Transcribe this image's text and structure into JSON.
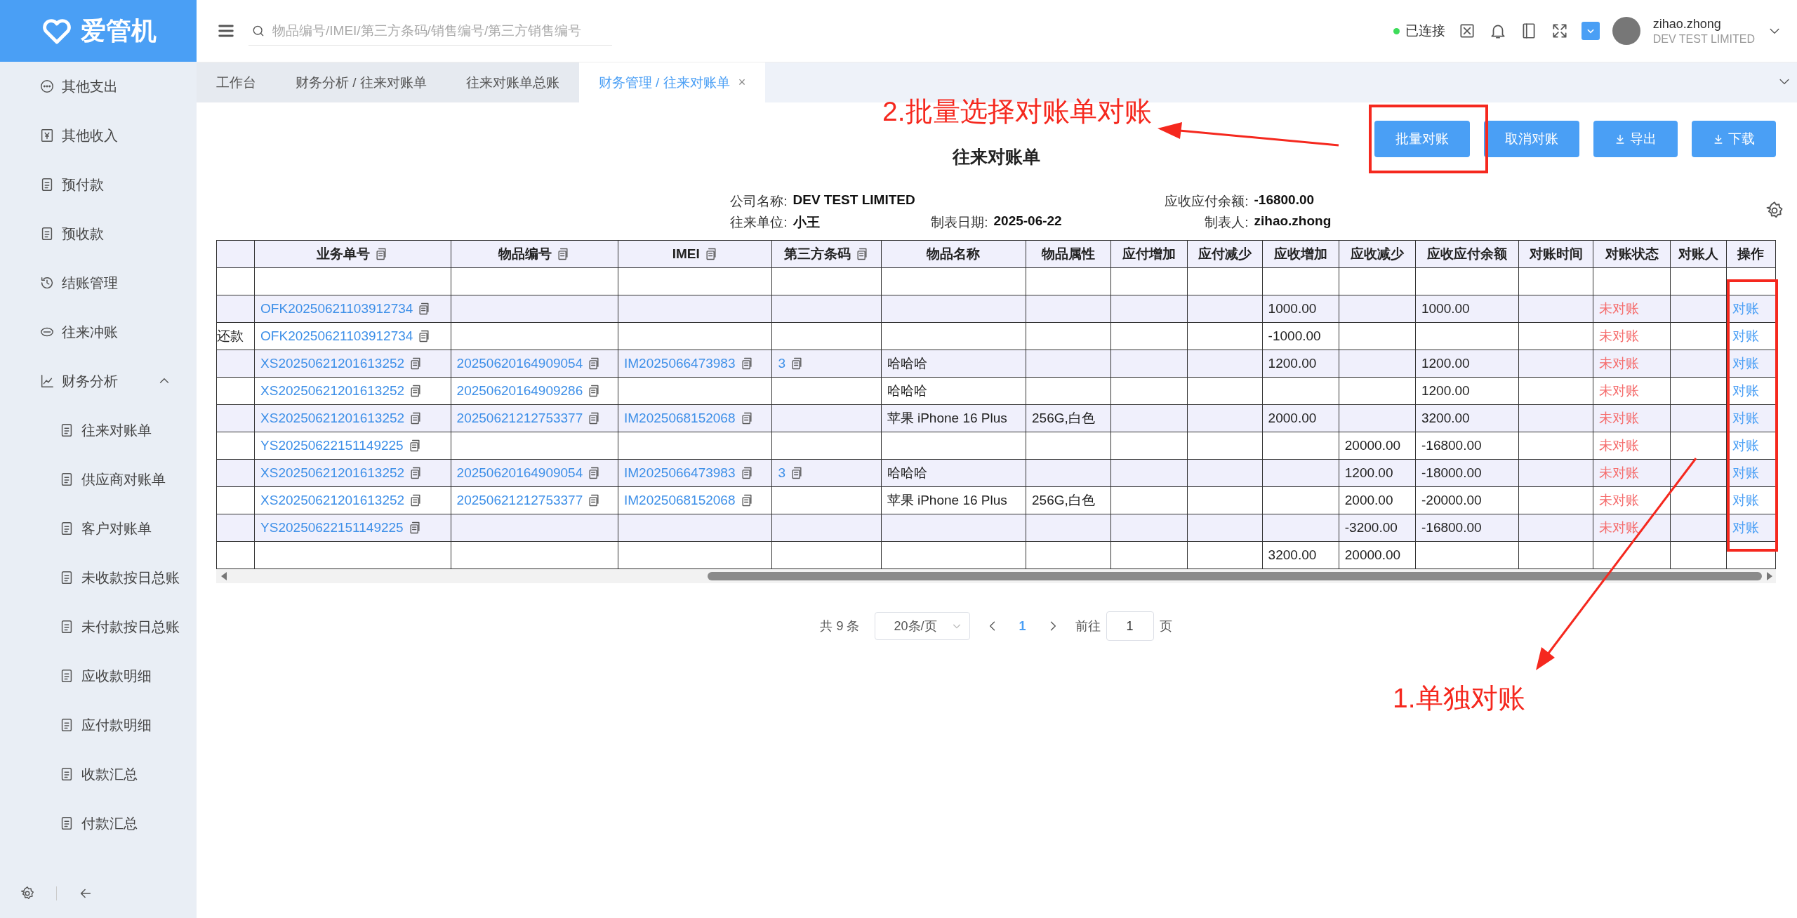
{
  "app": {
    "logo": "爱管机"
  },
  "sidebar": {
    "items": [
      {
        "label": "其他支出"
      },
      {
        "label": "其他收入"
      },
      {
        "label": "预付款"
      },
      {
        "label": "预收款"
      },
      {
        "label": "结账管理"
      },
      {
        "label": "往来冲账"
      },
      {
        "label": "财务分析",
        "expanded": true,
        "children": [
          {
            "label": "往来对账单"
          },
          {
            "label": "供应商对账单"
          },
          {
            "label": "客户对账单"
          },
          {
            "label": "未收款按日总账"
          },
          {
            "label": "未付款按日总账"
          },
          {
            "label": "应收款明细"
          },
          {
            "label": "应付款明细"
          },
          {
            "label": "收款汇总"
          },
          {
            "label": "付款汇总"
          }
        ]
      }
    ]
  },
  "header": {
    "search": {
      "placeholder": "物品编号/IMEI/第三方条码/销售编号/第三方销售编号"
    },
    "connection": {
      "label": "已连接",
      "connected": true
    },
    "user": {
      "name": "zihao.zhong",
      "company": "DEV TEST LIMITED"
    }
  },
  "tabs": [
    {
      "label": "工作台",
      "selected": false
    },
    {
      "label": "财务分析 / 往来对账单",
      "selected": false
    },
    {
      "label": "往来对账单总账",
      "selected": false
    },
    {
      "label": "财务管理 / 往来对账单",
      "selected": true,
      "close": "×"
    }
  ],
  "toolbar": {
    "buttons": [
      {
        "label": "批量对账",
        "kind": "plain"
      },
      {
        "label": "取消对账",
        "kind": "plain"
      },
      {
        "label": "导出",
        "kind": "download"
      },
      {
        "label": "下载",
        "kind": "download"
      }
    ]
  },
  "report": {
    "title": "往来对账单",
    "info": [
      {
        "label": "公司名称:",
        "value": "DEV TEST LIMITED"
      },
      {
        "label": "应收应付余额:",
        "value": "-16800.00"
      },
      {
        "label": "往来单位:",
        "value": "小王"
      },
      {
        "label": "制表日期:",
        "value": "2025-06-22"
      },
      {
        "label": "制表人:",
        "value": "zihao.zhong"
      }
    ]
  },
  "table": {
    "columns": [
      {
        "copy_icon": false
      },
      {
        "label": "业务单号",
        "copy_icon": true
      },
      {
        "label": "物品编号",
        "copy_icon": true
      },
      {
        "label": "IMEI",
        "copy_icon": true
      },
      {
        "label": "第三方条码",
        "copy_icon": true
      },
      {
        "label": "物品名称",
        "copy_icon": false
      },
      {
        "label": "物品属性",
        "copy_icon": false
      },
      {
        "label": "应付增加",
        "copy_icon": false
      },
      {
        "label": "应付减少",
        "copy_icon": false
      },
      {
        "label": "应收增加",
        "copy_icon": false
      },
      {
        "label": "应收减少",
        "copy_icon": false
      },
      {
        "label": "应收应付余额",
        "copy_icon": false
      },
      {
        "label": "对账时间",
        "copy_icon": false
      },
      {
        "label": "对账状态",
        "copy_icon": false
      },
      {
        "label": "对账人",
        "copy_icon": false
      },
      {
        "label": "操作",
        "copy_icon": false
      }
    ],
    "rows": [
      {
        "cells": [
          null,
          null,
          null,
          null,
          null,
          null,
          null,
          null,
          null,
          null,
          null,
          null,
          null,
          null,
          null,
          null
        ]
      },
      {
        "cells": [
          null,
          {
            "text": "OFK20250621103912734",
            "kind": "link",
            "copy_icon": true
          },
          null,
          null,
          null,
          null,
          null,
          null,
          null,
          {
            "text": "1000.00",
            "kind": "text"
          },
          null,
          {
            "text": "1000.00",
            "kind": "text"
          },
          null,
          {
            "text": "未对账",
            "kind": "status"
          },
          null,
          {
            "text": "对账",
            "kind": "action"
          }
        ]
      },
      {
        "cells": [
          {
            "text": "还款",
            "kind": "text"
          },
          {
            "text": "OFK20250621103912734",
            "kind": "link",
            "copy_icon": true
          },
          null,
          null,
          null,
          null,
          null,
          null,
          null,
          {
            "text": "-1000.00",
            "kind": "text"
          },
          null,
          null,
          null,
          {
            "text": "未对账",
            "kind": "status"
          },
          null,
          {
            "text": "对账",
            "kind": "action"
          }
        ]
      },
      {
        "cells": [
          null,
          {
            "text": "XS20250621201613252",
            "kind": "link",
            "copy_icon": true
          },
          {
            "text": "20250620164909054",
            "kind": "link",
            "copy_icon": true
          },
          {
            "text": "IM2025066473983",
            "kind": "link",
            "copy_icon": true
          },
          {
            "text": "3",
            "kind": "link",
            "copy_icon": true
          },
          {
            "text": "哈哈哈",
            "kind": "text"
          },
          null,
          null,
          null,
          {
            "text": "1200.00",
            "kind": "text"
          },
          null,
          {
            "text": "1200.00",
            "kind": "text"
          },
          null,
          {
            "text": "未对账",
            "kind": "status"
          },
          null,
          {
            "text": "对账",
            "kind": "action"
          }
        ]
      },
      {
        "cells": [
          null,
          {
            "text": "XS20250621201613252",
            "kind": "link",
            "copy_icon": true
          },
          {
            "text": "20250620164909286",
            "kind": "link",
            "copy_icon": true
          },
          null,
          null,
          {
            "text": "哈哈哈",
            "kind": "text"
          },
          null,
          null,
          null,
          null,
          null,
          {
            "text": "1200.00",
            "kind": "text"
          },
          null,
          {
            "text": "未对账",
            "kind": "status"
          },
          null,
          {
            "text": "对账",
            "kind": "action"
          }
        ]
      },
      {
        "cells": [
          null,
          {
            "text": "XS20250621201613252",
            "kind": "link",
            "copy_icon": true
          },
          {
            "text": "20250621212753377",
            "kind": "link",
            "copy_icon": true
          },
          {
            "text": "IM2025068152068",
            "kind": "link",
            "copy_icon": true
          },
          null,
          {
            "text": "苹果 iPhone 16 Plus",
            "kind": "text"
          },
          {
            "text": "256G,白色",
            "kind": "text"
          },
          null,
          null,
          {
            "text": "2000.00",
            "kind": "text"
          },
          null,
          {
            "text": "3200.00",
            "kind": "text"
          },
          null,
          {
            "text": "未对账",
            "kind": "status"
          },
          null,
          {
            "text": "对账",
            "kind": "action"
          }
        ]
      },
      {
        "cells": [
          null,
          {
            "text": "YS20250622151149225",
            "kind": "link",
            "copy_icon": true
          },
          null,
          null,
          null,
          null,
          null,
          null,
          null,
          null,
          {
            "text": "20000.00",
            "kind": "text"
          },
          {
            "text": "-16800.00",
            "kind": "text"
          },
          null,
          {
            "text": "未对账",
            "kind": "status"
          },
          null,
          {
            "text": "对账",
            "kind": "action"
          }
        ]
      },
      {
        "cells": [
          null,
          {
            "text": "XS20250621201613252",
            "kind": "link",
            "copy_icon": true
          },
          {
            "text": "20250620164909054",
            "kind": "link",
            "copy_icon": true
          },
          {
            "text": "IM2025066473983",
            "kind": "link",
            "copy_icon": true
          },
          {
            "text": "3",
            "kind": "link",
            "copy_icon": true
          },
          {
            "text": "哈哈哈",
            "kind": "text"
          },
          null,
          null,
          null,
          null,
          {
            "text": "1200.00",
            "kind": "text"
          },
          {
            "text": "-18000.00",
            "kind": "text"
          },
          null,
          {
            "text": "未对账",
            "kind": "status"
          },
          null,
          {
            "text": "对账",
            "kind": "action"
          }
        ]
      },
      {
        "cells": [
          null,
          {
            "text": "XS20250621201613252",
            "kind": "link",
            "copy_icon": true
          },
          {
            "text": "20250621212753377",
            "kind": "link",
            "copy_icon": true
          },
          {
            "text": "IM2025068152068",
            "kind": "link",
            "copy_icon": true
          },
          null,
          {
            "text": "苹果 iPhone 16 Plus",
            "kind": "text"
          },
          {
            "text": "256G,白色",
            "kind": "text"
          },
          null,
          null,
          null,
          {
            "text": "2000.00",
            "kind": "text"
          },
          {
            "text": "-20000.00",
            "kind": "text"
          },
          null,
          {
            "text": "未对账",
            "kind": "status"
          },
          null,
          {
            "text": "对账",
            "kind": "action"
          }
        ]
      },
      {
        "cells": [
          null,
          {
            "text": "YS20250622151149225",
            "kind": "link",
            "copy_icon": true
          },
          null,
          null,
          null,
          null,
          null,
          null,
          null,
          null,
          {
            "text": "-3200.00",
            "kind": "text"
          },
          {
            "text": "-16800.00",
            "kind": "text"
          },
          null,
          {
            "text": "未对账",
            "kind": "status"
          },
          null,
          {
            "text": "对账",
            "kind": "action"
          }
        ]
      },
      {
        "cells": [
          null,
          null,
          null,
          null,
          null,
          null,
          null,
          null,
          null,
          {
            "text": "3200.00",
            "kind": "text"
          },
          {
            "text": "20000.00",
            "kind": "text"
          },
          null,
          null,
          null,
          null,
          null
        ]
      }
    ]
  },
  "pagination": {
    "total": "共 9 条",
    "page_size": "20条/页",
    "pages": [
      {
        "label": "1",
        "selected": true
      }
    ],
    "goto_label": "前往",
    "goto_value": "1",
    "goto_suffix": "页"
  },
  "annotations": [
    {
      "text": "2.批量选择对账单对账"
    },
    {
      "text": "1.单独对账"
    }
  ]
}
